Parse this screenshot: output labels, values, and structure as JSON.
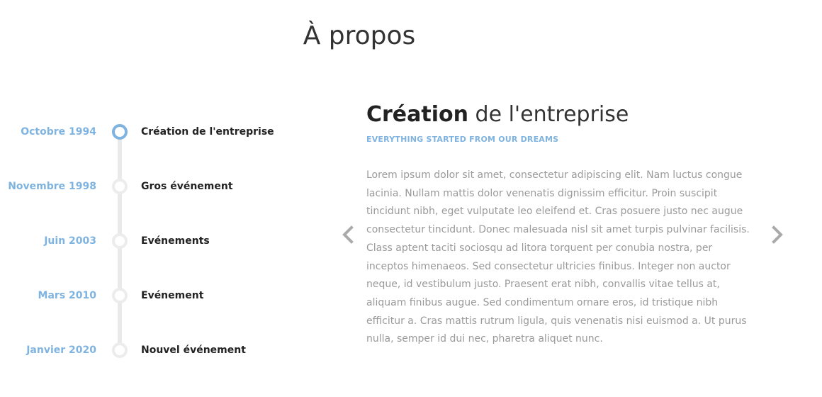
{
  "page": {
    "title": "À propos"
  },
  "timeline": {
    "items": [
      {
        "date": "Octobre 1994",
        "label": "Création de l'entreprise",
        "active": true
      },
      {
        "date": "Novembre 1998",
        "label": "Gros événement",
        "active": false
      },
      {
        "date": "Juin 2003",
        "label": "Evénements",
        "active": false
      },
      {
        "date": "Mars 2010",
        "label": "Evénement",
        "active": false
      },
      {
        "date": "Janvier 2020",
        "label": "Nouvel événement",
        "active": false
      }
    ]
  },
  "content": {
    "heading_bold": "Création",
    "heading_rest": " de l'entreprise",
    "subtitle": "EVERYTHING STARTED FROM OUR DREAMS",
    "body": "Lorem ipsum dolor sit amet, consectetur adipiscing elit. Nam luctus congue lacinia. Nullam mattis dolor venenatis dignissim efficitur. Proin suscipit tincidunt nibh, eget vulputate leo eleifend et. Cras posuere justo nec augue consectetur tincidunt. Donec malesuada nisl sit amet turpis pulvinar facilisis. Class aptent taciti sociosqu ad litora torquent per conubia nostra, per inceptos himenaeos. Sed consectetur ultricies finibus. Integer non auctor neque, id vestibulum justo. Praesent erat nibh, convallis vitae tellus at, aliquam finibus augue. Sed condimentum ornare eros, id tristique nibh efficitur a. Cras mattis rutrum ligula, quis venenatis nisi euismod a. Ut purus nulla, semper id dui nec, pharetra aliquet nunc."
  },
  "navigation": {
    "prev_icon": "chevron-left-icon",
    "next_icon": "chevron-right-icon"
  },
  "colors": {
    "accent": "#7fb3e0",
    "timeline_track": "#e9e9e9",
    "body_text": "#9a9a9a",
    "heading_text": "#333333",
    "arrow": "#aaaaaa"
  }
}
